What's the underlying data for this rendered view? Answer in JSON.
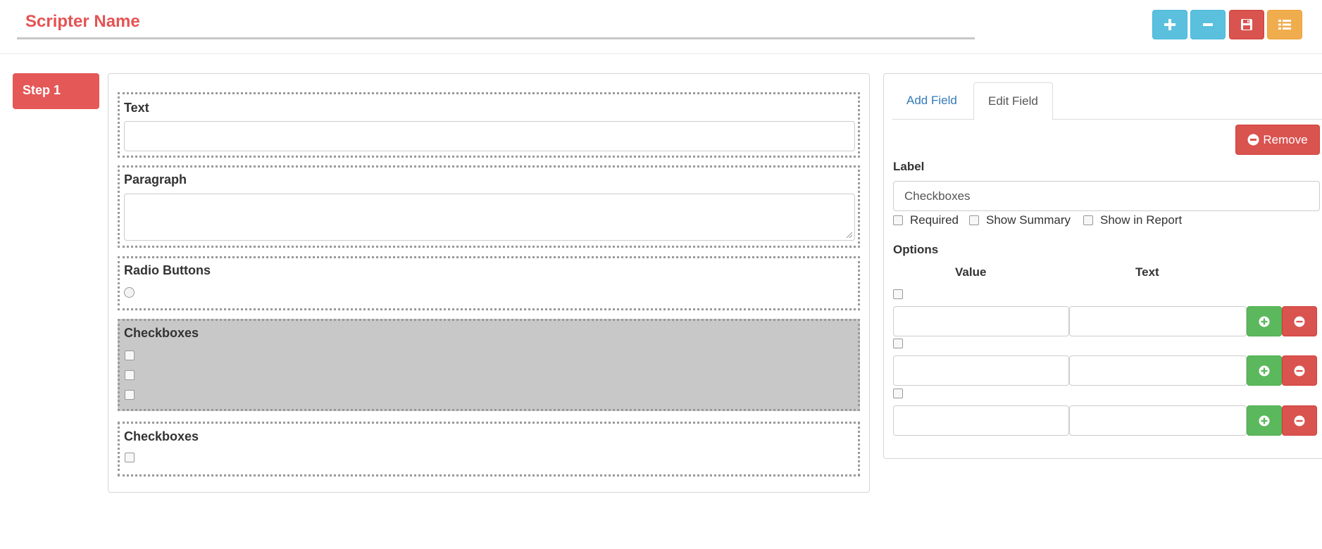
{
  "header": {
    "script_name": "Scripter Name",
    "toolbar": [
      {
        "name": "add-step-button",
        "icon": "plus-icon"
      },
      {
        "name": "remove-step-button",
        "icon": "minus-icon"
      },
      {
        "name": "save-button",
        "icon": "floppy-disk-icon"
      },
      {
        "name": "list-button",
        "icon": "list-icon"
      }
    ]
  },
  "steps": [
    {
      "label": "Step 1",
      "active": true
    }
  ],
  "form": {
    "fields": [
      {
        "type": "text",
        "label": "Text"
      },
      {
        "type": "paragraph",
        "label": "Paragraph"
      },
      {
        "type": "radio",
        "label": "Radio Buttons",
        "options": 1
      },
      {
        "type": "checkbox",
        "label": "Checkboxes",
        "options": 3,
        "selected": true
      },
      {
        "type": "checkbox",
        "label": "Checkboxes",
        "options": 1
      }
    ]
  },
  "panel": {
    "tabs": {
      "add": "Add Field",
      "edit": "Edit Field",
      "active": "edit"
    },
    "remove_label": "Remove",
    "label_heading": "Label",
    "label_value": "Checkboxes",
    "flags": {
      "required": "Required",
      "show_summary": "Show Summary",
      "show_in_report": "Show in Report"
    },
    "options_heading": "Options",
    "columns": {
      "value": "Value",
      "text": "Text"
    },
    "option_rows": [
      {
        "value": "",
        "text": ""
      },
      {
        "value": "",
        "text": ""
      },
      {
        "value": "",
        "text": ""
      }
    ]
  },
  "colors": {
    "brand_red": "#e55353",
    "info": "#5bc0de",
    "danger": "#d9534f",
    "warning": "#f0ad4e",
    "success": "#5cb85c",
    "selected_field_bg": "#c8c8c8"
  }
}
